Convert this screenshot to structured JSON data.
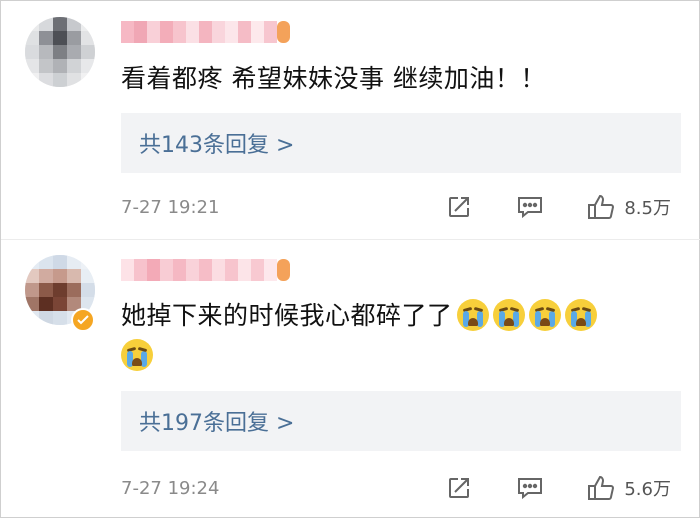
{
  "comments": [
    {
      "username": "",
      "text": "看着都疼 希望妹妹没事 继续加油！！",
      "replies_label": "共143条回复 >",
      "time": "7-27 19:21",
      "like_count": "8.5万"
    },
    {
      "username": "",
      "text": "她掉下来的时候我心都碎了了",
      "emoji_count": 5,
      "replies_label": "共197条回复 >",
      "time": "7-27 19:24",
      "like_count": "5.6万"
    }
  ],
  "icons": {
    "share": "share-icon",
    "reply": "comment-icon",
    "like": "thumbs-up-icon",
    "emoji": "crying-face-emoji",
    "verified": "verified-badge-icon"
  },
  "colors": {
    "reply_link": "#4a6f96",
    "reply_bg": "#f2f3f5",
    "meta_text": "#8a8a8a",
    "verified": "#f5a623"
  }
}
